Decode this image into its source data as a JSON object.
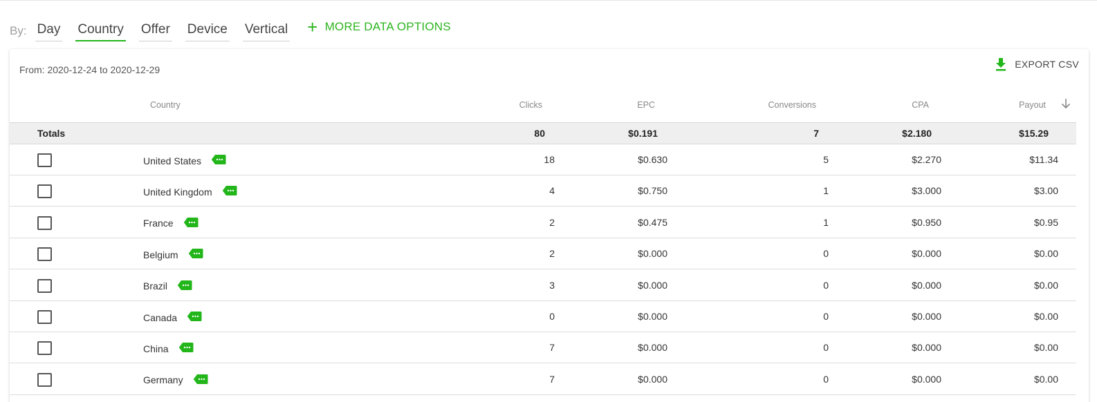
{
  "filters": {
    "by_label": "By:",
    "tabs": [
      {
        "label": "Day",
        "active": false
      },
      {
        "label": "Country",
        "active": true
      },
      {
        "label": "Offer",
        "active": false
      },
      {
        "label": "Device",
        "active": false
      },
      {
        "label": "Vertical",
        "active": false
      }
    ],
    "more_options_label": "MORE DATA OPTIONS",
    "more_options_icon": "plus-icon"
  },
  "report": {
    "range_text": "From: 2020-12-24 to 2020-12-29",
    "export_label": "EXPORT CSV",
    "export_icon": "download-icon"
  },
  "table": {
    "columns": {
      "country": "Country",
      "clicks": "Clicks",
      "epc": "EPC",
      "conversions": "Conversions",
      "cpa": "CPA",
      "payout": "Payout"
    },
    "sort_icon": "arrow-down-icon",
    "totals": {
      "label": "Totals",
      "clicks": "80",
      "epc": "$0.191",
      "conversions": "7",
      "cpa": "$2.180",
      "payout": "$15.29"
    },
    "rows": [
      {
        "country": "United States",
        "clicks": "18",
        "epc": "$0.630",
        "conversions": "5",
        "cpa": "$2.270",
        "payout": "$11.34"
      },
      {
        "country": "United Kingdom",
        "clicks": "4",
        "epc": "$0.750",
        "conversions": "1",
        "cpa": "$3.000",
        "payout": "$3.00"
      },
      {
        "country": "France",
        "clicks": "2",
        "epc": "$0.475",
        "conversions": "1",
        "cpa": "$0.950",
        "payout": "$0.95"
      },
      {
        "country": "Belgium",
        "clicks": "2",
        "epc": "$0.000",
        "conversions": "0",
        "cpa": "$0.000",
        "payout": "$0.00"
      },
      {
        "country": "Brazil",
        "clicks": "3",
        "epc": "$0.000",
        "conversions": "0",
        "cpa": "$0.000",
        "payout": "$0.00"
      },
      {
        "country": "Canada",
        "clicks": "0",
        "epc": "$0.000",
        "conversions": "0",
        "cpa": "$0.000",
        "payout": "$0.00"
      },
      {
        "country": "China",
        "clicks": "7",
        "epc": "$0.000",
        "conversions": "0",
        "cpa": "$0.000",
        "payout": "$0.00"
      },
      {
        "country": "Germany",
        "clicks": "7",
        "epc": "$0.000",
        "conversions": "0",
        "cpa": "$0.000",
        "payout": "$0.00"
      }
    ],
    "tag_icon": "tag-icon"
  },
  "colors": {
    "accent": "#22b61a",
    "totals_bg": "#efefef"
  }
}
